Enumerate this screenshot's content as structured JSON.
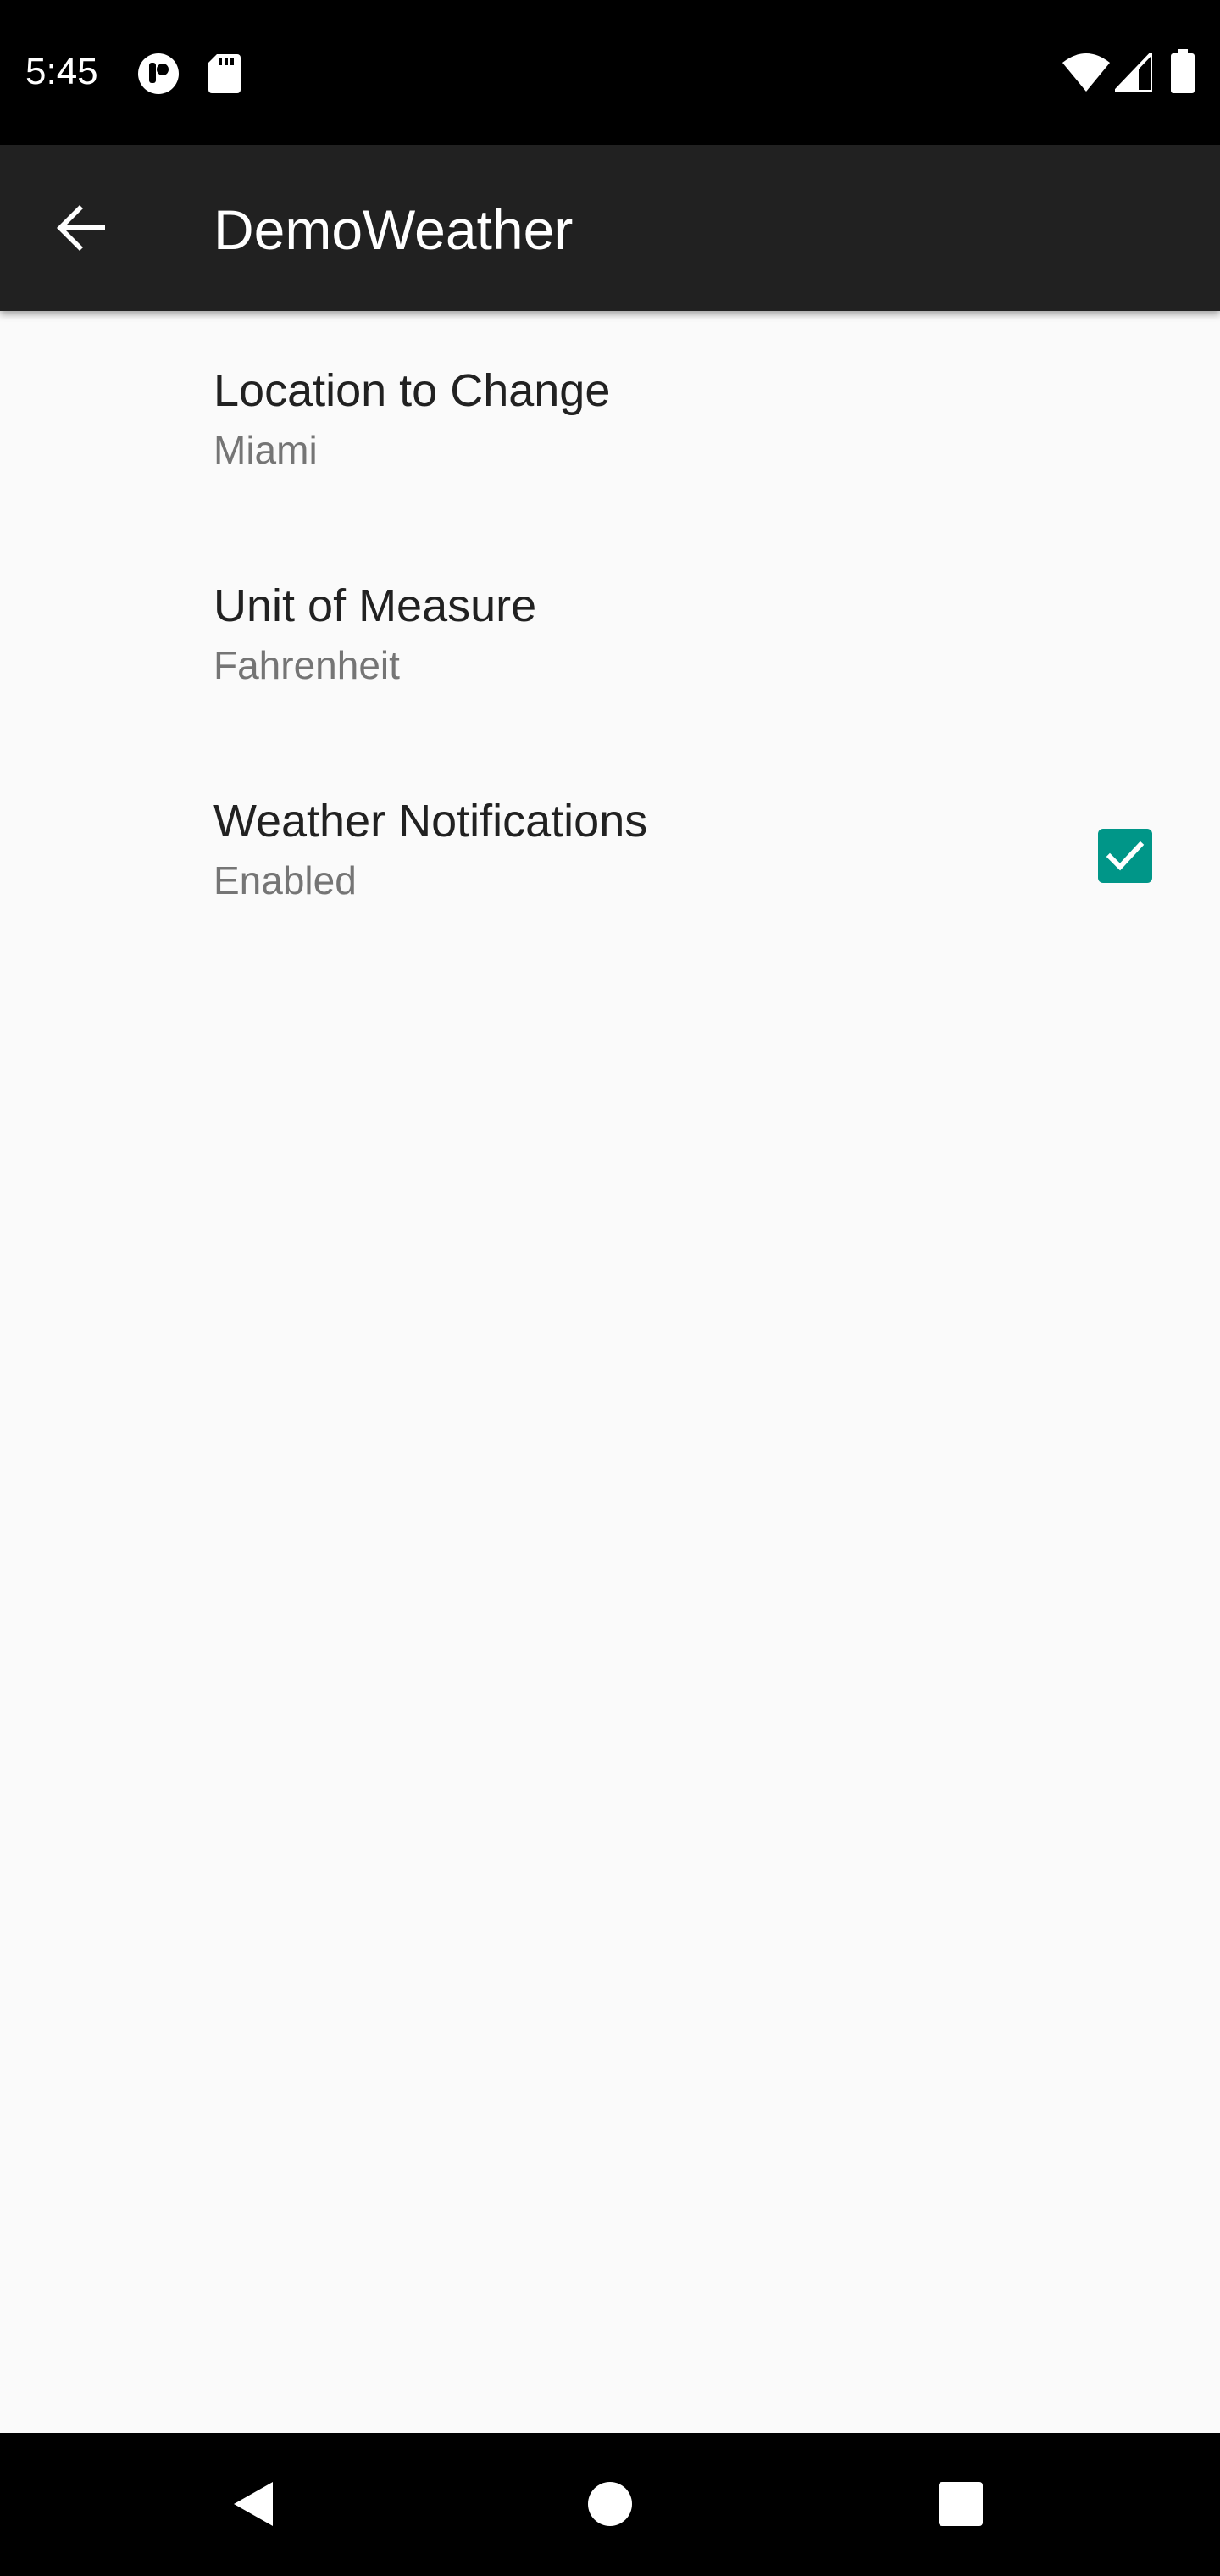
{
  "status_bar": {
    "time": "5:45",
    "left_icons": [
      "podcast-app-icon",
      "sd-card-icon"
    ],
    "right_icons": [
      "wifi-icon",
      "cell-signal-icon",
      "battery-icon"
    ]
  },
  "app_bar": {
    "back_icon": "arrow-back-icon",
    "title": "DemoWeather"
  },
  "preferences": [
    {
      "title": "Location to Change",
      "summary": "Miami"
    },
    {
      "title": "Unit of Measure",
      "summary": "Fahrenheit"
    },
    {
      "title": "Weather Notifications",
      "summary": "Enabled",
      "checkbox": true,
      "checked": true
    }
  ],
  "nav_bar": {
    "buttons": [
      "back-triangle-icon",
      "home-circle-icon",
      "recents-square-icon"
    ]
  },
  "colors": {
    "status_bar": "#000000",
    "app_bar": "#212121",
    "background": "#fafafa",
    "accent": "#009688",
    "title_text": "#212121",
    "summary_text": "#757575"
  }
}
